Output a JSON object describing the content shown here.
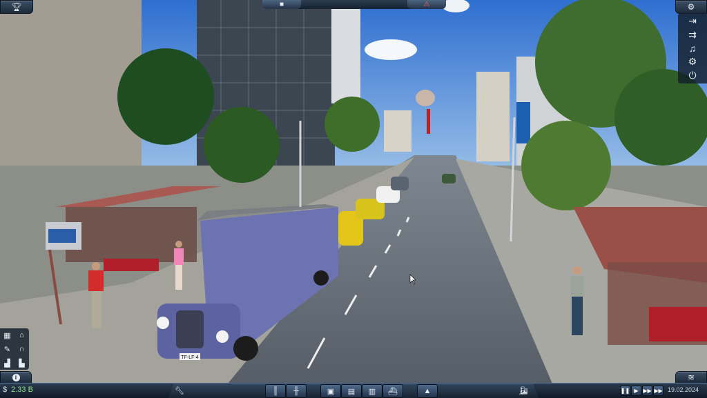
{
  "top_bar": {
    "left_icon": "trophy-icon",
    "center_left_icon": "info-icon",
    "center_right_icon": "warning-icon",
    "settings_icon": "gear-icon"
  },
  "right_menu": {
    "items": [
      "enter-exit-icon",
      "convoy-icon",
      "music-icon",
      "settings-icon",
      "power-icon"
    ]
  },
  "left_menu": {
    "items": [
      "station-icon",
      "depot-icon",
      "tools-icon",
      "tunnel-icon",
      "town-icon",
      "industry-icon"
    ]
  },
  "bottom_bar": {
    "currency_symbol": "$",
    "money": "2.33 B",
    "info_icon": "info-icon",
    "tools_icon": "wrench-icon",
    "build_buttons": [
      "road-icon",
      "street-icon",
      "rail-icon",
      "bus-icon",
      "truck-icon",
      "ship-icon",
      "terrain-icon"
    ],
    "train_icon": "train-icon",
    "date": "19.02.2024",
    "speed_buttons": [
      "pause-icon",
      "play-icon",
      "fast-icon",
      "fastest-icon"
    ],
    "layers_icon": "layers-icon"
  },
  "scene": {
    "bus_plate": "TF-LF-4"
  }
}
